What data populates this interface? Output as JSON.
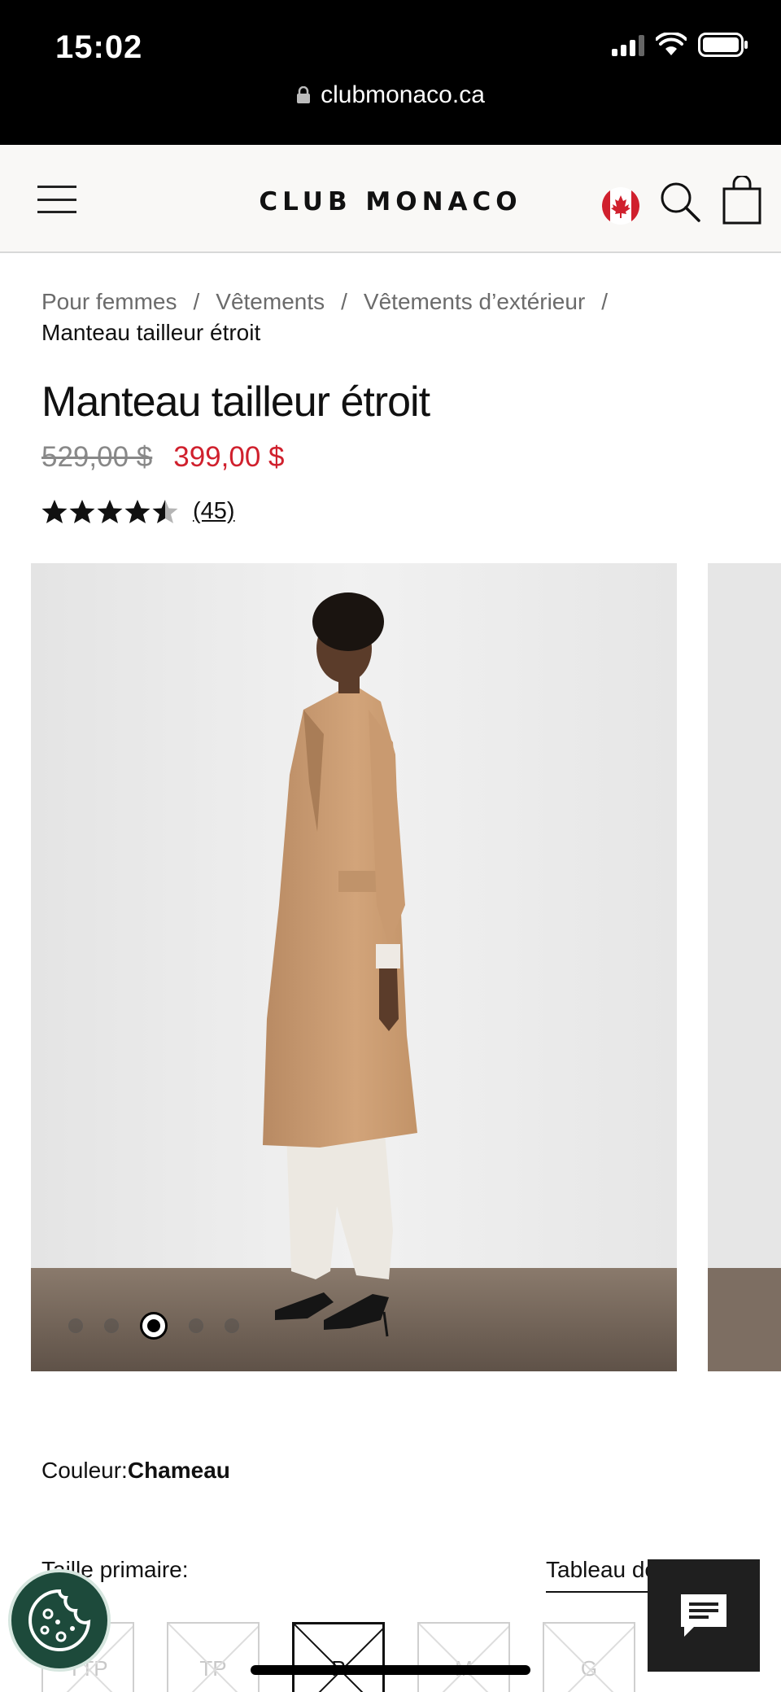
{
  "status_bar": {
    "time": "15:02",
    "url": "clubmonaco.ca"
  },
  "header": {
    "logo": "CLUB MONACO"
  },
  "breadcrumb": [
    "Pour femmes",
    "Vêtements",
    "Vêtements d’extérieur",
    "Manteau tailleur étroit"
  ],
  "breadcrumb_separator": "/",
  "product": {
    "title": "Manteau tailleur étroit",
    "old_price": "529,00 $",
    "sale_price": "399,00 $",
    "rating": 4.5,
    "review_count": "(45)"
  },
  "carousel": {
    "slide_count": 5,
    "active_slide": 3
  },
  "color": {
    "label": "Couleur:",
    "value": "Chameau"
  },
  "size": {
    "label": "Taille primaire:",
    "chart_link": "Tableau des tailles",
    "options": [
      "TTP",
      "TP",
      "P",
      "M",
      "G"
    ],
    "selected": "P"
  },
  "colors": {
    "sale": "#d0202d",
    "cookie_bg": "#1d4a3b",
    "chat_bg": "#1f1f1f"
  },
  "icons": [
    "menu-icon",
    "canada-flag-icon",
    "search-icon",
    "shopping-bag-icon",
    "cookie-icon",
    "chat-icon",
    "lock-icon"
  ]
}
